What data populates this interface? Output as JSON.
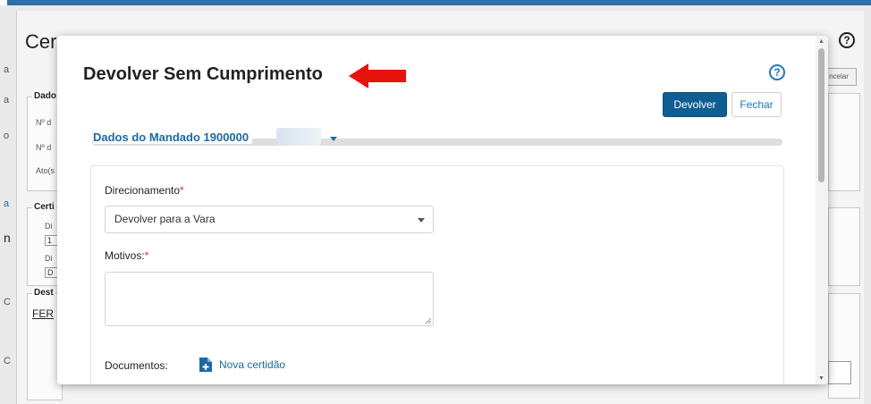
{
  "background": {
    "title_partial": "Cer",
    "help_symbol": "?",
    "cancel_label": "ncelar",
    "left_strip_chars": [
      "a",
      "a",
      "o",
      "a",
      "n",
      "C",
      "C"
    ],
    "fieldset_dados": {
      "legend": "Dado",
      "rows": [
        "Nº d",
        "Nº d",
        "Ato(s"
      ]
    },
    "fieldset_certi": {
      "legend": "Certi",
      "row1_label": "Di",
      "row1_value": "1",
      "row2_label": "Di",
      "row2_value": "D"
    },
    "fieldset_dest": {
      "legend": "Dest",
      "link": "FER"
    }
  },
  "modal": {
    "title": "Devolver Sem Cumprimento",
    "help_symbol": "?",
    "buttons": {
      "devolver": "Devolver",
      "fechar": "Fechar"
    },
    "tab_title": "Dados do Mandado 1900000",
    "form": {
      "direcionamento_label": "Direcionamento",
      "direcionamento_value": "Devolver para a Vara",
      "motivos_label": "Motivos:",
      "required_mark": "*",
      "documentos_label": "Documentos:",
      "nova_certidao": "Nova certidão"
    }
  },
  "colors": {
    "primary_button": "#0e5e93",
    "link_blue": "#1b6aa6",
    "required_red": "#d9302a",
    "arrow_red": "#e8120c"
  },
  "icons": [
    "help-icon",
    "red-arrow-icon",
    "chevron-down-icon",
    "new-document-icon"
  ]
}
